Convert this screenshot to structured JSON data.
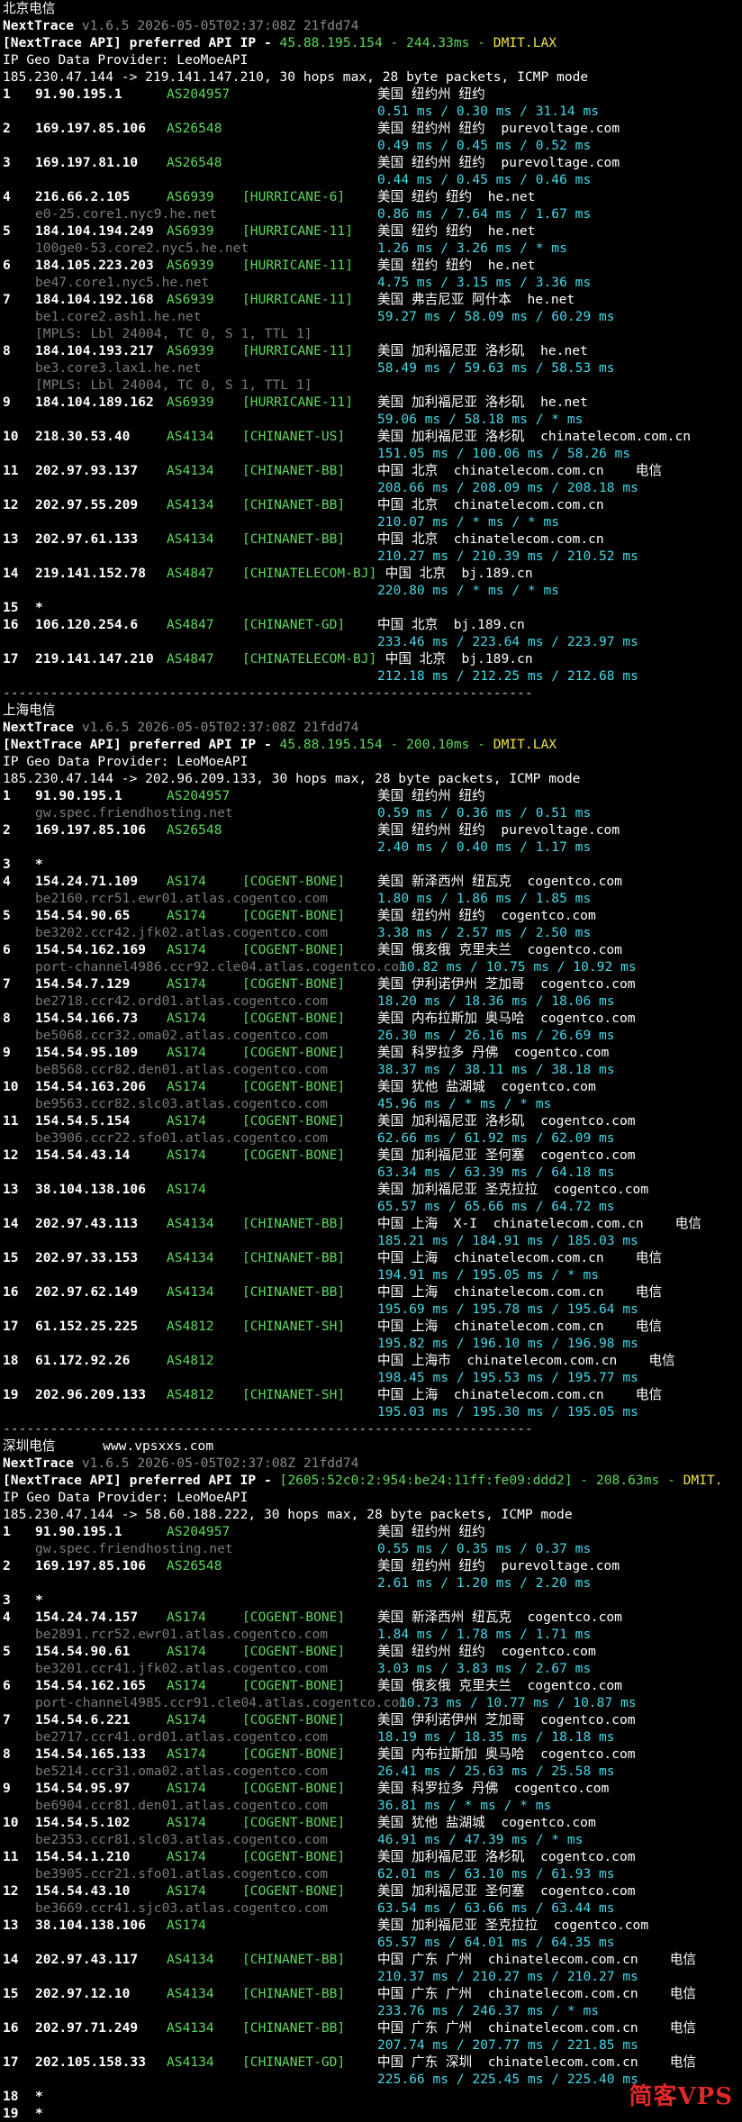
{
  "sections": [
    {
      "title": "北京电信",
      "version": "v1.6.5 2026-05-05T02:37:08Z 21fdd74",
      "api_ip": "45.88.195.154",
      "api_rtt": "244.33ms",
      "api_node": "DMIT.LAX",
      "provider": "IP Geo Data Provider: LeoMoeAPI",
      "trace": "185.230.47.144 -> 219.141.147.210, 30 hops max, 28 byte packets, ICMP mode",
      "hops": [
        {
          "n": "1",
          "ip": "91.90.195.1",
          "as": "AS204957",
          "tag": "",
          "geo": "美国 纽约州 纽约",
          "dom": "",
          "extra": "",
          "rtt": "0.51 ms / 0.30 ms / 31.14 ms",
          "host": "",
          "mpls": ""
        },
        {
          "n": "2",
          "ip": "169.197.85.106",
          "as": "AS26548",
          "tag": "",
          "geo": "美国 纽约州 纽约",
          "dom": "purevoltage.com",
          "extra": "",
          "rtt": "0.49 ms / 0.45 ms / 0.52 ms",
          "host": "",
          "mpls": ""
        },
        {
          "n": "3",
          "ip": "169.197.81.10",
          "as": "AS26548",
          "tag": "",
          "geo": "美国 纽约州 纽约",
          "dom": "purevoltage.com",
          "extra": "",
          "rtt": "0.44 ms / 0.45 ms / 0.46 ms",
          "host": "",
          "mpls": ""
        },
        {
          "n": "4",
          "ip": "216.66.2.105",
          "as": "AS6939",
          "tag": "[HURRICANE-6]",
          "geo": "美国 纽约 纽约",
          "dom": "he.net",
          "extra": "",
          "rtt": "0.86 ms / 7.64 ms / 1.67 ms",
          "host": "e0-25.core1.nyc9.he.net",
          "mpls": ""
        },
        {
          "n": "5",
          "ip": "184.104.194.249",
          "as": "AS6939",
          "tag": "[HURRICANE-11]",
          "geo": "美国 纽约 纽约",
          "dom": "he.net",
          "extra": "",
          "rtt": "1.26 ms / 3.26 ms / * ms",
          "host": "100ge0-53.core2.nyc5.he.net",
          "mpls": ""
        },
        {
          "n": "6",
          "ip": "184.105.223.203",
          "as": "AS6939",
          "tag": "[HURRICANE-11]",
          "geo": "美国 纽约 纽约",
          "dom": "he.net",
          "extra": "",
          "rtt": "4.75 ms / 3.15 ms / 3.36 ms",
          "host": "be47.core1.nyc5.he.net",
          "mpls": ""
        },
        {
          "n": "7",
          "ip": "184.104.192.168",
          "as": "AS6939",
          "tag": "[HURRICANE-11]",
          "geo": "美国 弗吉尼亚 阿什本",
          "dom": "he.net",
          "extra": "",
          "rtt": "59.27 ms / 58.09 ms / 60.29 ms",
          "host": "be1.core2.ash1.he.net",
          "mpls": "[MPLS: Lbl 24004, TC 0, S 1, TTL 1]"
        },
        {
          "n": "8",
          "ip": "184.104.193.217",
          "as": "AS6939",
          "tag": "[HURRICANE-11]",
          "geo": "美国 加利福尼亚 洛杉矶",
          "dom": "he.net",
          "extra": "",
          "rtt": "58.49 ms / 59.63 ms / 58.53 ms",
          "host": "be3.core3.lax1.he.net",
          "mpls": "[MPLS: Lbl 24004, TC 0, S 1, TTL 1]"
        },
        {
          "n": "9",
          "ip": "184.104.189.162",
          "as": "AS6939",
          "tag": "[HURRICANE-11]",
          "geo": "美国 加利福尼亚 洛杉矶",
          "dom": "he.net",
          "extra": "",
          "rtt": "59.06 ms / 58.18 ms / * ms",
          "host": "",
          "mpls": ""
        },
        {
          "n": "10",
          "ip": "218.30.53.40",
          "as": "AS4134",
          "tag": "[CHINANET-US]",
          "geo": "美国 加利福尼亚 洛杉矶",
          "dom": "chinatelecom.com.cn",
          "extra": "",
          "rtt": "151.05 ms / 100.06 ms / 58.26 ms",
          "host": "",
          "mpls": ""
        },
        {
          "n": "11",
          "ip": "202.97.93.137",
          "as": "AS4134",
          "tag": "[CHINANET-BB]",
          "geo": "中国 北京",
          "dom": "chinatelecom.com.cn",
          "extra": "电信",
          "rtt": "208.66 ms / 208.09 ms / 208.18 ms",
          "host": "",
          "mpls": ""
        },
        {
          "n": "12",
          "ip": "202.97.55.209",
          "as": "AS4134",
          "tag": "[CHINANET-BB]",
          "geo": "中国 北京",
          "dom": "chinatelecom.com.cn",
          "extra": "",
          "rtt": "210.07 ms / * ms / * ms",
          "host": "",
          "mpls": ""
        },
        {
          "n": "13",
          "ip": "202.97.61.133",
          "as": "AS4134",
          "tag": "[CHINANET-BB]",
          "geo": "中国 北京",
          "dom": "chinatelecom.com.cn",
          "extra": "",
          "rtt": "210.27 ms / 210.39 ms / 210.52 ms",
          "host": "",
          "mpls": ""
        },
        {
          "n": "14",
          "ip": "219.141.152.78",
          "as": "AS4847",
          "tag": "[CHINATELECOM-BJ]",
          "geo": " 中国 北京",
          "dom": "bj.189.cn",
          "extra": "",
          "rtt": "220.80 ms / * ms / * ms",
          "host": "",
          "mpls": ""
        },
        {
          "n": "15",
          "ip": "*",
          "as": "",
          "tag": "",
          "geo": "",
          "dom": "",
          "extra": "",
          "rtt": "",
          "host": "",
          "mpls": ""
        },
        {
          "n": "16",
          "ip": "106.120.254.6",
          "as": "AS4847",
          "tag": "[CHINANET-GD]",
          "geo": "中国 北京",
          "dom": "bj.189.cn",
          "extra": "",
          "rtt": "233.46 ms / 223.64 ms / 223.97 ms",
          "host": "",
          "mpls": ""
        },
        {
          "n": "17",
          "ip": "219.141.147.210",
          "as": "AS4847",
          "tag": "[CHINATELECOM-BJ]",
          "geo": " 中国 北京",
          "dom": "bj.189.cn",
          "extra": "",
          "rtt": "212.18 ms / 212.25 ms / 212.68 ms",
          "host": "",
          "mpls": ""
        }
      ]
    },
    {
      "title": "上海电信",
      "version": "v1.6.5 2026-05-05T02:37:08Z 21fdd74",
      "api_ip": "45.88.195.154",
      "api_rtt": "200.10ms",
      "api_node": "DMIT.LAX",
      "provider": "IP Geo Data Provider: LeoMoeAPI",
      "trace": "185.230.47.144 -> 202.96.209.133, 30 hops max, 28 byte packets, ICMP mode",
      "hops": [
        {
          "n": "1",
          "ip": "91.90.195.1",
          "as": "AS204957",
          "tag": "",
          "geo": "美国 纽约州 纽约",
          "dom": "",
          "extra": "",
          "rtt": "0.59 ms / 0.36 ms / 0.51 ms",
          "host": "gw.spec.friendhosting.net",
          "mpls": ""
        },
        {
          "n": "2",
          "ip": "169.197.85.106",
          "as": "AS26548",
          "tag": "",
          "geo": "美国 纽约州 纽约",
          "dom": "purevoltage.com",
          "extra": "",
          "rtt": "2.40 ms / 0.40 ms / 1.17 ms",
          "host": "",
          "mpls": ""
        },
        {
          "n": "3",
          "ip": "*",
          "as": "",
          "tag": "",
          "geo": "",
          "dom": "",
          "extra": "",
          "rtt": "",
          "host": "",
          "mpls": ""
        },
        {
          "n": "4",
          "ip": "154.24.71.109",
          "as": "AS174",
          "tag": "[COGENT-BONE]",
          "geo": "美国 新泽西州 纽瓦克",
          "dom": "cogentco.com",
          "extra": "",
          "rtt": "1.80 ms / 1.86 ms / 1.85 ms",
          "host": "be2160.rcr51.ewr01.atlas.cogentco.com",
          "mpls": ""
        },
        {
          "n": "5",
          "ip": "154.54.90.65",
          "as": "AS174",
          "tag": "[COGENT-BONE]",
          "geo": "美国 纽约州 纽约",
          "dom": "cogentco.com",
          "extra": "",
          "rtt": "3.38 ms / 2.57 ms / 2.50 ms",
          "host": "be3202.ccr42.jfk02.atlas.cogentco.com",
          "mpls": ""
        },
        {
          "n": "6",
          "ip": "154.54.162.169",
          "as": "AS174",
          "tag": "[COGENT-BONE]",
          "geo": "美国 俄亥俄 克里夫兰",
          "dom": "cogentco.com",
          "extra": "",
          "rtt": "10.82 ms / 10.75 ms / 10.92 ms",
          "host": "port-channel4986.ccr92.cle04.atlas.cogentco.com",
          "mpls": ""
        },
        {
          "n": "7",
          "ip": "154.54.7.129",
          "as": "AS174",
          "tag": "[COGENT-BONE]",
          "geo": "美国 伊利诺伊州 芝加哥",
          "dom": "cogentco.com",
          "extra": "",
          "rtt": "18.20 ms / 18.36 ms / 18.06 ms",
          "host": "be2718.ccr42.ord01.atlas.cogentco.com",
          "mpls": ""
        },
        {
          "n": "8",
          "ip": "154.54.166.73",
          "as": "AS174",
          "tag": "[COGENT-BONE]",
          "geo": "美国 内布拉斯加 奥马哈",
          "dom": "cogentco.com",
          "extra": "",
          "rtt": "26.30 ms / 26.16 ms / 26.69 ms",
          "host": "be5068.ccr32.oma02.atlas.cogentco.com",
          "mpls": ""
        },
        {
          "n": "9",
          "ip": "154.54.95.109",
          "as": "AS174",
          "tag": "[COGENT-BONE]",
          "geo": "美国 科罗拉多 丹佛",
          "dom": "cogentco.com",
          "extra": "",
          "rtt": "38.37 ms / 38.11 ms / 38.18 ms",
          "host": "be8568.ccr82.den01.atlas.cogentco.com",
          "mpls": ""
        },
        {
          "n": "10",
          "ip": "154.54.163.206",
          "as": "AS174",
          "tag": "[COGENT-BONE]",
          "geo": "美国 犹他 盐湖城",
          "dom": "cogentco.com",
          "extra": "",
          "rtt": "45.96 ms / * ms / * ms",
          "host": "be9563.ccr82.slc03.atlas.cogentco.com",
          "mpls": ""
        },
        {
          "n": "11",
          "ip": "154.54.5.154",
          "as": "AS174",
          "tag": "[COGENT-BONE]",
          "geo": "美国 加利福尼亚 洛杉矶",
          "dom": "cogentco.com",
          "extra": "",
          "rtt": "62.66 ms / 61.92 ms / 62.09 ms",
          "host": "be3906.ccr22.sfo01.atlas.cogentco.com",
          "mpls": ""
        },
        {
          "n": "12",
          "ip": "154.54.43.14",
          "as": "AS174",
          "tag": "[COGENT-BONE]",
          "geo": "美国 加利福尼亚 圣何塞",
          "dom": "cogentco.com",
          "extra": "",
          "rtt": "63.34 ms / 63.39 ms / 64.18 ms",
          "host": "",
          "mpls": ""
        },
        {
          "n": "13",
          "ip": "38.104.138.106",
          "as": "AS174",
          "tag": "",
          "geo": "美国 加利福尼亚 圣克拉拉",
          "dom": "cogentco.com",
          "extra": "",
          "rtt": "65.57 ms / 65.66 ms / 64.72 ms",
          "host": "",
          "mpls": ""
        },
        {
          "n": "14",
          "ip": "202.97.43.113",
          "as": "AS4134",
          "tag": "[CHINANET-BB]",
          "geo": "中国 上海  X-I",
          "dom": "chinatelecom.com.cn",
          "extra": "电信",
          "rtt": "185.21 ms / 184.91 ms / 185.03 ms",
          "host": "",
          "mpls": ""
        },
        {
          "n": "15",
          "ip": "202.97.33.153",
          "as": "AS4134",
          "tag": "[CHINANET-BB]",
          "geo": "中国 上海",
          "dom": "chinatelecom.com.cn",
          "extra": "电信",
          "rtt": "194.91 ms / 195.05 ms / * ms",
          "host": "",
          "mpls": ""
        },
        {
          "n": "16",
          "ip": "202.97.62.149",
          "as": "AS4134",
          "tag": "[CHINANET-BB]",
          "geo": "中国 上海",
          "dom": "chinatelecom.com.cn",
          "extra": "电信",
          "rtt": "195.69 ms / 195.78 ms / 195.64 ms",
          "host": "",
          "mpls": ""
        },
        {
          "n": "17",
          "ip": "61.152.25.225",
          "as": "AS4812",
          "tag": "[CHINANET-SH]",
          "geo": "中国 上海",
          "dom": "chinatelecom.com.cn",
          "extra": "电信",
          "rtt": "195.82 ms / 196.10 ms / 196.98 ms",
          "host": "",
          "mpls": ""
        },
        {
          "n": "18",
          "ip": "61.172.92.26",
          "as": "AS4812",
          "tag": "",
          "geo": "中国 上海市",
          "dom": "chinatelecom.com.cn",
          "extra": "电信",
          "rtt": "198.45 ms / 195.53 ms / 195.77 ms",
          "host": "",
          "mpls": ""
        },
        {
          "n": "19",
          "ip": "202.96.209.133",
          "as": "AS4812",
          "tag": "[CHINANET-SH]",
          "geo": "中国 上海",
          "dom": "chinatelecom.com.cn",
          "extra": "电信",
          "rtt": "195.03 ms / 195.30 ms / 195.05 ms",
          "host": "",
          "mpls": ""
        }
      ]
    },
    {
      "title": "深圳电信      www.vpsxxs.com",
      "version": "v1.6.5 2026-05-05T02:37:08Z 21fdd74",
      "api_ip": "[2605:52c0:2:954:be24:11ff:fe09:ddd2]",
      "api_rtt": "208.63ms",
      "api_node": "DMIT.",
      "provider": "IP Geo Data Provider: LeoMoeAPI",
      "trace": "185.230.47.144 -> 58.60.188.222, 30 hops max, 28 byte packets, ICMP mode",
      "hops": [
        {
          "n": "1",
          "ip": "91.90.195.1",
          "as": "AS204957",
          "tag": "",
          "geo": "美国 纽约州 纽约",
          "dom": "",
          "extra": "",
          "rtt": "0.55 ms / 0.35 ms / 0.37 ms",
          "host": "gw.spec.friendhosting.net",
          "mpls": ""
        },
        {
          "n": "2",
          "ip": "169.197.85.106",
          "as": "AS26548",
          "tag": "",
          "geo": "美国 纽约州 纽约",
          "dom": "purevoltage.com",
          "extra": "",
          "rtt": "2.61 ms / 1.20 ms / 2.20 ms",
          "host": "",
          "mpls": ""
        },
        {
          "n": "3",
          "ip": "*",
          "as": "",
          "tag": "",
          "geo": "",
          "dom": "",
          "extra": "",
          "rtt": "",
          "host": "",
          "mpls": ""
        },
        {
          "n": "4",
          "ip": "154.24.74.157",
          "as": "AS174",
          "tag": "[COGENT-BONE]",
          "geo": "美国 新泽西州 纽瓦克",
          "dom": "cogentco.com",
          "extra": "",
          "rtt": "1.84 ms / 1.78 ms / 1.71 ms",
          "host": "be2891.rcr52.ewr01.atlas.cogentco.com",
          "mpls": ""
        },
        {
          "n": "5",
          "ip": "154.54.90.61",
          "as": "AS174",
          "tag": "[COGENT-BONE]",
          "geo": "美国 纽约州 纽约",
          "dom": "cogentco.com",
          "extra": "",
          "rtt": "3.03 ms / 3.83 ms / 2.67 ms",
          "host": "be3201.ccr41.jfk02.atlas.cogentco.com",
          "mpls": ""
        },
        {
          "n": "6",
          "ip": "154.54.162.165",
          "as": "AS174",
          "tag": "[COGENT-BONE]",
          "geo": "美国 俄亥俄 克里夫兰",
          "dom": "cogentco.com",
          "extra": "",
          "rtt": "10.73 ms / 10.77 ms / 10.87 ms",
          "host": "port-channel4985.ccr91.cle04.atlas.cogentco.com",
          "mpls": ""
        },
        {
          "n": "7",
          "ip": "154.54.6.221",
          "as": "AS174",
          "tag": "[COGENT-BONE]",
          "geo": "美国 伊利诺伊州 芝加哥",
          "dom": "cogentco.com",
          "extra": "",
          "rtt": "18.19 ms / 18.35 ms / 18.18 ms",
          "host": "be2717.ccr41.ord01.atlas.cogentco.com",
          "mpls": ""
        },
        {
          "n": "8",
          "ip": "154.54.165.133",
          "as": "AS174",
          "tag": "[COGENT-BONE]",
          "geo": "美国 内布拉斯加 奥马哈",
          "dom": "cogentco.com",
          "extra": "",
          "rtt": "26.41 ms / 25.63 ms / 25.58 ms",
          "host": "be5214.ccr31.oma02.atlas.cogentco.com",
          "mpls": ""
        },
        {
          "n": "9",
          "ip": "154.54.95.97",
          "as": "AS174",
          "tag": "[COGENT-BONE]",
          "geo": "美国 科罗拉多 丹佛",
          "dom": "cogentco.com",
          "extra": "",
          "rtt": "36.81 ms / * ms / * ms",
          "host": "be6904.ccr81.den01.atlas.cogentco.com",
          "mpls": ""
        },
        {
          "n": "10",
          "ip": "154.54.5.102",
          "as": "AS174",
          "tag": "[COGENT-BONE]",
          "geo": "美国 犹他 盐湖城",
          "dom": "cogentco.com",
          "extra": "",
          "rtt": "46.91 ms / 47.39 ms / * ms",
          "host": "be2353.ccr81.slc03.atlas.cogentco.com",
          "mpls": ""
        },
        {
          "n": "11",
          "ip": "154.54.1.210",
          "as": "AS174",
          "tag": "[COGENT-BONE]",
          "geo": "美国 加利福尼亚 洛杉矶",
          "dom": "cogentco.com",
          "extra": "",
          "rtt": "62.01 ms / 63.10 ms / 61.93 ms",
          "host": "be3905.ccr21.sfo01.atlas.cogentco.com",
          "mpls": ""
        },
        {
          "n": "12",
          "ip": "154.54.43.10",
          "as": "AS174",
          "tag": "[COGENT-BONE]",
          "geo": "美国 加利福尼亚 圣何塞",
          "dom": "cogentco.com",
          "extra": "",
          "rtt": "63.54 ms / 63.66 ms / 63.44 ms",
          "host": "be3669.ccr41.sjc03.atlas.cogentco.com",
          "mpls": ""
        },
        {
          "n": "13",
          "ip": "38.104.138.106",
          "as": "AS174",
          "tag": "",
          "geo": "美国 加利福尼亚 圣克拉拉",
          "dom": "cogentco.com",
          "extra": "",
          "rtt": "65.57 ms / 64.01 ms / 64.35 ms",
          "host": "",
          "mpls": ""
        },
        {
          "n": "14",
          "ip": "202.97.43.117",
          "as": "AS4134",
          "tag": "[CHINANET-BB]",
          "geo": "中国 广东 广州",
          "dom": "chinatelecom.com.cn",
          "extra": "电信",
          "rtt": "210.37 ms / 210.27 ms / 210.27 ms",
          "host": "",
          "mpls": ""
        },
        {
          "n": "15",
          "ip": "202.97.12.10",
          "as": "AS4134",
          "tag": "[CHINANET-BB]",
          "geo": "中国 广东 广州",
          "dom": "chinatelecom.com.cn",
          "extra": "电信",
          "rtt": "233.76 ms / 246.37 ms / * ms",
          "host": "",
          "mpls": ""
        },
        {
          "n": "16",
          "ip": "202.97.71.249",
          "as": "AS4134",
          "tag": "[CHINANET-BB]",
          "geo": "中国 广东 广州",
          "dom": "chinatelecom.com.cn",
          "extra": "电信",
          "rtt": "207.74 ms / 207.77 ms / 221.85 ms",
          "host": "",
          "mpls": ""
        },
        {
          "n": "17",
          "ip": "202.105.158.33",
          "as": "AS4134",
          "tag": "[CHINANET-GD]",
          "geo": "中国 广东 深圳",
          "dom": "chinatelecom.com.cn",
          "extra": "电信",
          "rtt": "225.66 ms / 225.45 ms / 225.40 ms",
          "host": "",
          "mpls": ""
        },
        {
          "n": "18",
          "ip": "*",
          "as": "",
          "tag": "",
          "geo": "",
          "dom": "",
          "extra": "",
          "rtt": "",
          "host": "",
          "mpls": ""
        },
        {
          "n": "19",
          "ip": "*",
          "as": "",
          "tag": "",
          "geo": "",
          "dom": "",
          "extra": "",
          "rtt": "",
          "host": "",
          "mpls": ""
        }
      ]
    }
  ],
  "labels": {
    "nexttrace": "NextTrace",
    "api_prefix": "[NextTrace API] preferred API IP - ",
    "divider": "-------------------------------------------------------------------"
  },
  "watermark": "简客VPS",
  "colors": {
    "background": "#000000",
    "green": "#5fd75f",
    "cyan": "#45d8e6",
    "yellow": "#f0e04a",
    "gray": "#7a7a7a"
  }
}
